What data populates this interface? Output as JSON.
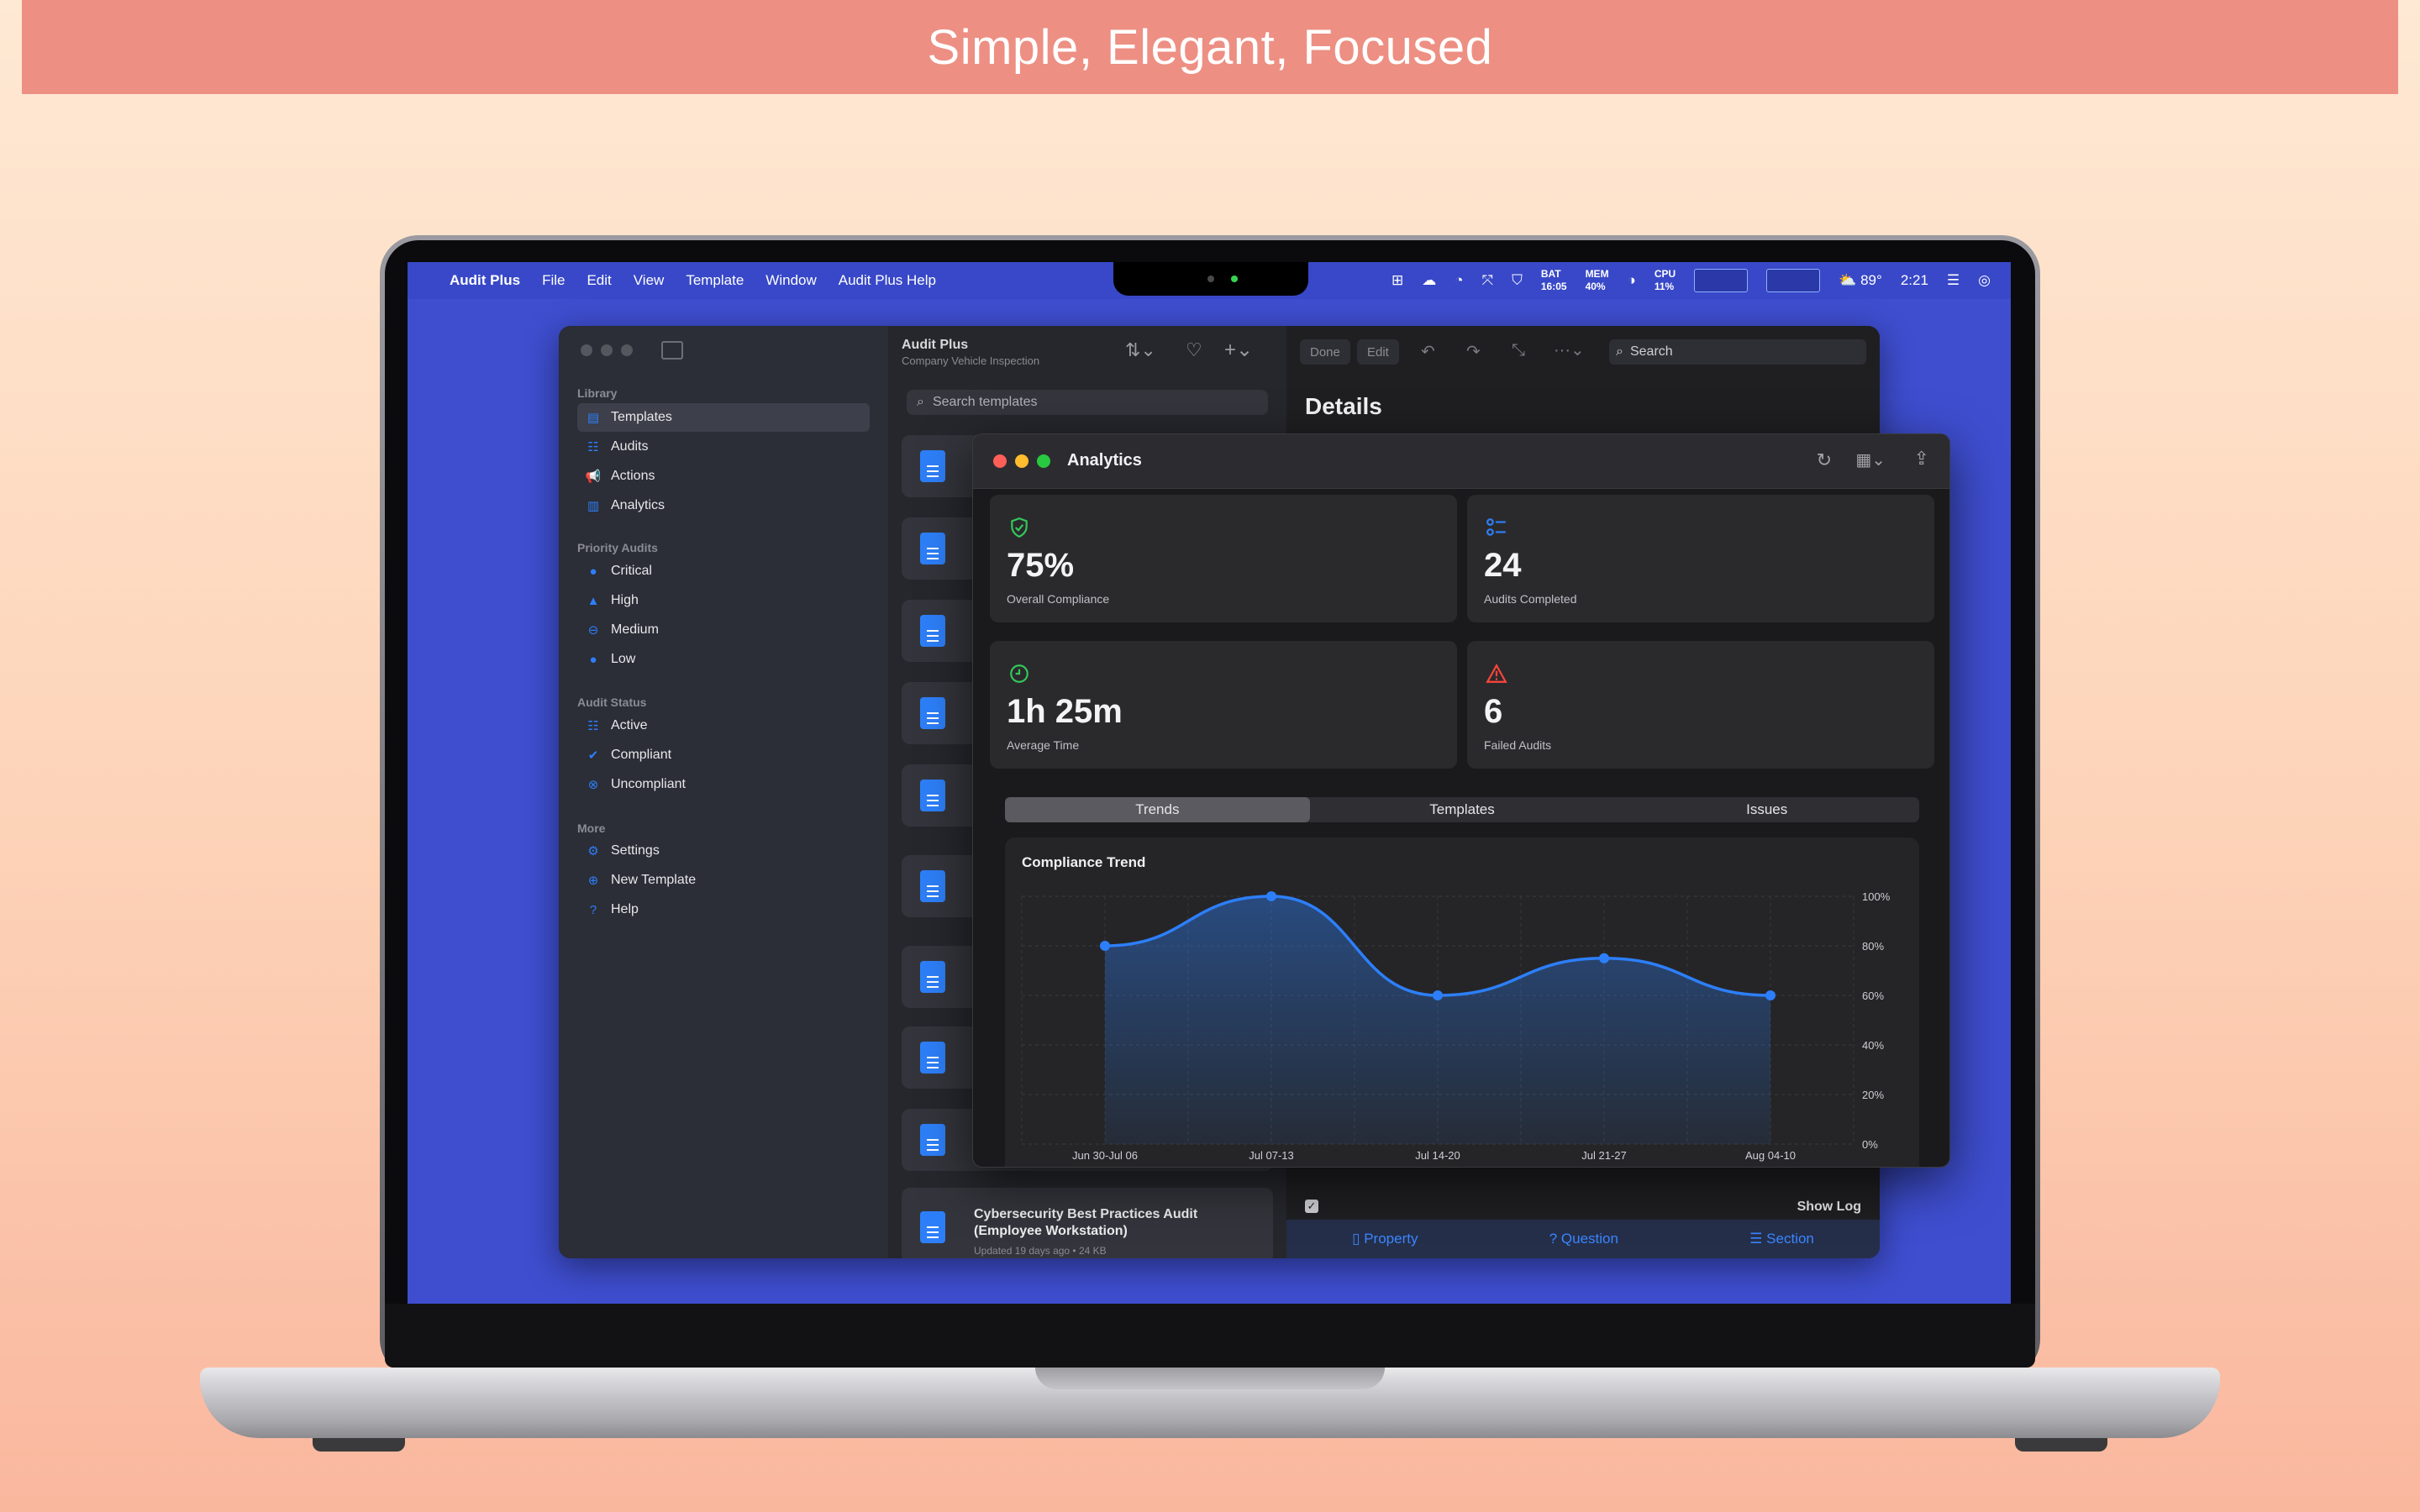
{
  "banner": {
    "text": "Simple, Elegant, Focused"
  },
  "menubar": {
    "apple": "",
    "app": "Audit Plus",
    "items": [
      "File",
      "Edit",
      "View",
      "Template",
      "Window",
      "Audit Plus Help"
    ],
    "status": {
      "bat_label": "BAT",
      "bat_value": "16:05",
      "mem_label": "MEM",
      "mem_value": "40%",
      "cpu_label": "CPU",
      "cpu_value": "11%",
      "weather": "89°",
      "clock": "2:21"
    }
  },
  "sidebar": {
    "sections": [
      {
        "title": "Library",
        "items": [
          {
            "label": "Templates",
            "icon": "doc-icon",
            "selected": true
          },
          {
            "label": "Audits",
            "icon": "list-icon"
          },
          {
            "label": "Actions",
            "icon": "megaphone-icon"
          },
          {
            "label": "Analytics",
            "icon": "chart-icon"
          }
        ]
      },
      {
        "title": "Priority Audits",
        "items": [
          {
            "label": "Critical",
            "icon": "exclamation-icon"
          },
          {
            "label": "High",
            "icon": "warning-icon"
          },
          {
            "label": "Medium",
            "icon": "minus-circle-icon"
          },
          {
            "label": "Low",
            "icon": "circle-icon"
          }
        ]
      },
      {
        "title": "Audit Status",
        "items": [
          {
            "label": "Active",
            "icon": "list-icon"
          },
          {
            "label": "Compliant",
            "icon": "check-circle-icon"
          },
          {
            "label": "Uncompliant",
            "icon": "x-circle-icon"
          }
        ]
      },
      {
        "title": "More",
        "items": [
          {
            "label": "Settings",
            "icon": "gear-icon"
          },
          {
            "label": "New Template",
            "icon": "plus-circle-icon"
          },
          {
            "label": "Help",
            "icon": "question-icon"
          }
        ]
      }
    ]
  },
  "list": {
    "title": "Audit Plus",
    "subtitle": "Company Vehicle Inspection",
    "search_placeholder": "Search templates",
    "last_card": {
      "title": "Cybersecurity Best Practices Audit (Employee Workstation)",
      "meta": "Updated 19 days ago • 24 KB"
    }
  },
  "detail": {
    "buttons": {
      "done": "Done",
      "edit": "Edit"
    },
    "search_placeholder": "Search",
    "title": "Details",
    "show_log": "Show Log",
    "bottom": {
      "property": "Property",
      "question": "Question",
      "section": "Section"
    }
  },
  "analytics": {
    "title": "Analytics",
    "tiles": [
      {
        "value": "75%",
        "label": "Overall Compliance",
        "icon": "shield-check-icon",
        "color": "#34c759"
      },
      {
        "value": "24",
        "label": "Audits Completed",
        "icon": "list-icon",
        "color": "#2d7ff9"
      },
      {
        "value": "1h 25m",
        "label": "Average Time",
        "icon": "clock-icon",
        "color": "#34c759"
      },
      {
        "value": "6",
        "label": "Failed Audits",
        "icon": "warning-icon",
        "color": "#ff453a"
      }
    ],
    "tabs": [
      {
        "label": "Trends",
        "selected": true
      },
      {
        "label": "Templates"
      },
      {
        "label": "Issues"
      }
    ]
  },
  "chart_data": {
    "type": "area",
    "title": "Compliance Trend",
    "categories": [
      "Jun 30-Jul 06",
      "Jul 07-13",
      "Jul 14-20",
      "Jul 21-27",
      "Aug 04-10"
    ],
    "values": [
      80,
      100,
      60,
      75,
      60
    ],
    "yticks": [
      "0%",
      "20%",
      "40%",
      "60%",
      "80%",
      "100%"
    ],
    "ylim": [
      0,
      100
    ],
    "color": "#2d7ff9",
    "grid": true
  }
}
